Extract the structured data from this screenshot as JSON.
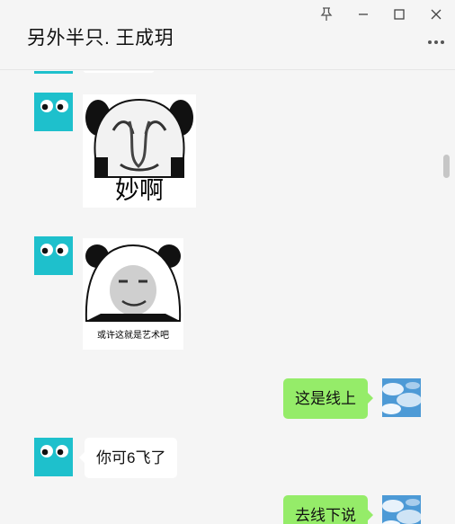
{
  "chat": {
    "title": "另外半只. 王成玥"
  },
  "window_controls": {
    "pin": "pin-icon",
    "minimize": "minimize-icon",
    "maximize": "maximize-icon",
    "close": "close-icon",
    "more": "more-icon"
  },
  "messages": {
    "sticker_1_caption": "妙啊",
    "sticker_2_caption": "或许这就是艺术吧",
    "out_1_text": "这是线上",
    "in_1_text": "你可6飞了",
    "out_2_text": "去线下说"
  },
  "colors": {
    "outgoing_bubble": "#95ec69",
    "incoming_bubble": "#ffffff",
    "bot_avatar": "#1ec0cc",
    "background": "#f5f5f5"
  }
}
